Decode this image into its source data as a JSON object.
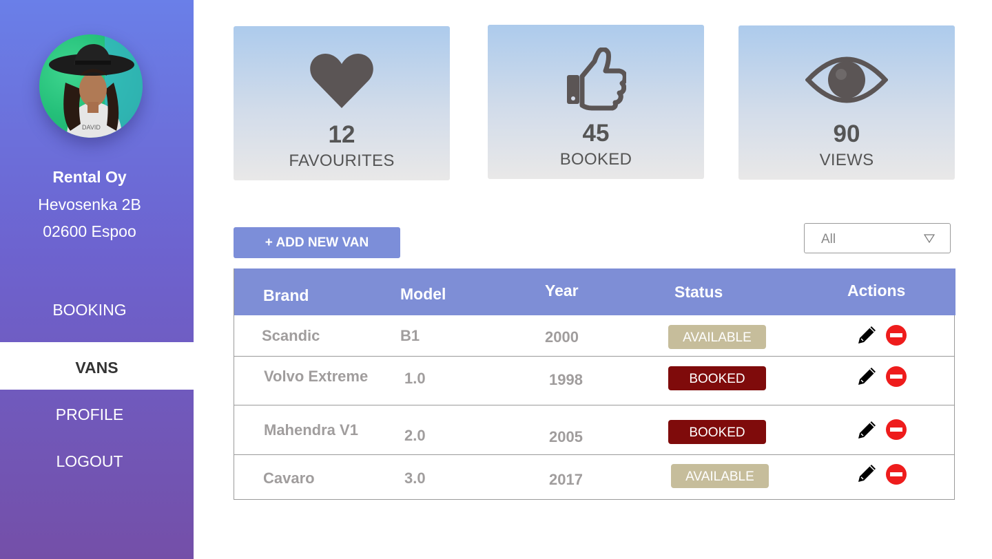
{
  "sidebar": {
    "company_name": "Rental Oy",
    "address_line1": "Hevosenka 2B",
    "address_line2": "02600 Espoo",
    "nav": {
      "booking": "BOOKING",
      "vans": "VANS",
      "profile": "PROFILE",
      "logout": "LOGOUT"
    },
    "active_item": "VANS"
  },
  "stats": {
    "favourites": {
      "value": "12",
      "label": "FAVOURITES",
      "icon": "heart-icon"
    },
    "booked": {
      "value": "45",
      "label": "BOOKED",
      "icon": "thumbs-up-icon"
    },
    "views": {
      "value": "90",
      "label": "VIEWS",
      "icon": "eye-icon"
    }
  },
  "toolbar": {
    "add_button": "+ ADD NEW VAN",
    "filter_value": "All"
  },
  "table": {
    "headers": {
      "brand": "Brand",
      "model": "Model",
      "year": "Year",
      "status": "Status",
      "actions": "Actions"
    },
    "rows": [
      {
        "brand": "Scandic",
        "model": "B1",
        "year": "2000",
        "status": "AVAILABLE"
      },
      {
        "brand": "Volvo Extreme",
        "model": "1.0",
        "year": "1998",
        "status": "BOOKED"
      },
      {
        "brand": "Mahendra V1",
        "model": "2.0",
        "year": "2005",
        "status": "BOOKED"
      },
      {
        "brand": "Cavaro",
        "model": "3.0",
        "year": "2017",
        "status": "AVAILABLE"
      }
    ]
  },
  "colors": {
    "accent": "#7c8ed9",
    "available": "#c6bd9b",
    "booked": "#7f0b0b",
    "delete": "#ee1c1c",
    "sidebar_top": "#6a7fe8",
    "sidebar_bottom": "#744fa8"
  }
}
